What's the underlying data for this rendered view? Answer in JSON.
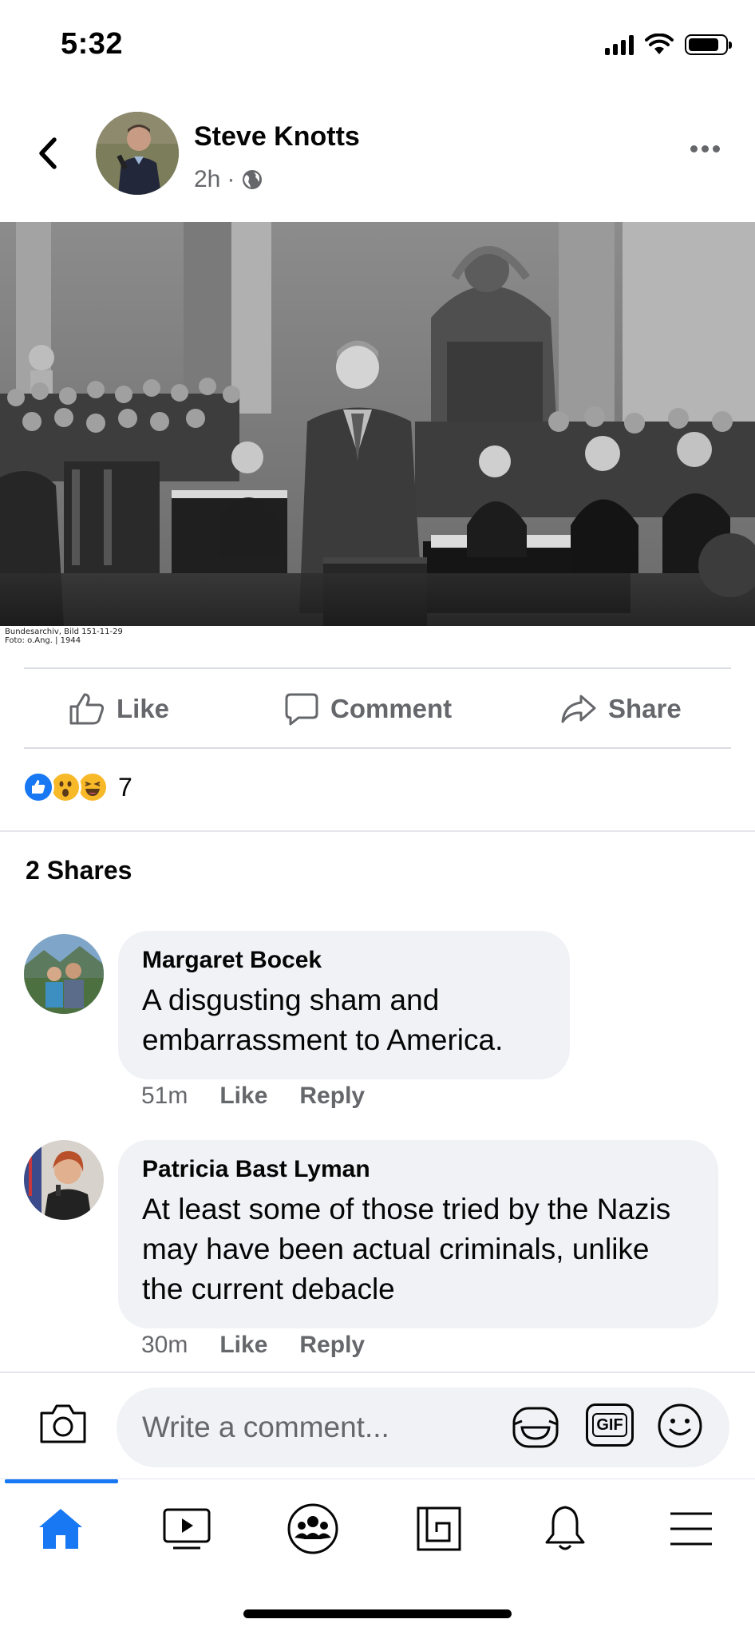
{
  "status_bar": {
    "time": "5:32"
  },
  "post": {
    "author": "Steve Knotts",
    "time": "2h",
    "separator": "·",
    "photo_credit_line1": "Bundesarchiv, Bild 151-11-29",
    "photo_credit_line2": "Foto: o.Ang. | 1944"
  },
  "actions": {
    "like": "Like",
    "comment": "Comment",
    "share": "Share"
  },
  "reactions": {
    "icons": [
      "like-reaction-icon",
      "wow-reaction-icon",
      "haha-reaction-icon"
    ],
    "count": "7"
  },
  "shares_text": "2 Shares",
  "comments": [
    {
      "author": "Margaret Bocek",
      "text": "A disgusting sham and embarrassment to America.",
      "time": "51m",
      "like": "Like",
      "reply": "Reply"
    },
    {
      "author": "Patricia Bast Lyman",
      "text": "At least some of those tried by the Nazis may have been actual criminals, unlike the current debacle",
      "time": "30m",
      "like": "Like",
      "reply": "Reply"
    }
  ],
  "composer": {
    "placeholder": "Write a comment...",
    "gif_label": "GIF"
  },
  "nav": {
    "items": [
      "home-icon",
      "watch-icon",
      "groups-icon",
      "marketplace-icon",
      "notifications-icon",
      "menu-icon"
    ],
    "active": "home-icon"
  },
  "colors": {
    "accent": "#1877f2",
    "secondary_text": "#65676b",
    "bubble": "#f0f2f5"
  }
}
